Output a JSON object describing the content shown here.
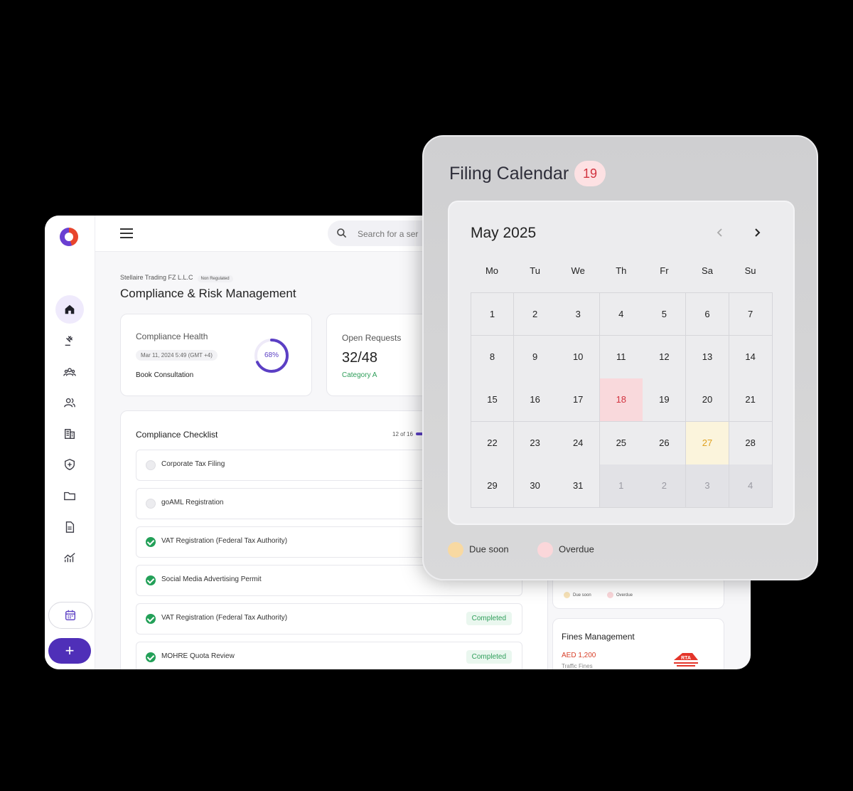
{
  "app": {
    "search_placeholder": "Search for a ser",
    "company": "Stellaire Trading FZ L.L.C",
    "company_badge": "Non Regulated",
    "page_title": "Compliance & Risk Management",
    "health": {
      "label": "Compliance Health",
      "date": "Mar 11, 2024 5:49 (GMT +4)",
      "book": "Book Consultation",
      "percent": "68%",
      "percent_value": 68
    },
    "requests": {
      "label": "Open Requests",
      "value": "32/48",
      "category": "Category A"
    },
    "checklist": {
      "title": "Compliance Checklist",
      "count": "12 of 16",
      "items": [
        {
          "label": "Corporate Tax Filing",
          "done": false,
          "status": ""
        },
        {
          "label": "goAML Registration",
          "done": false,
          "status": ""
        },
        {
          "label": "VAT Registration (Federal Tax Authority)",
          "done": true,
          "status": ""
        },
        {
          "label": "Social Media Advertising Permit",
          "done": true,
          "status": ""
        },
        {
          "label": "VAT Registration (Federal Tax Authority)",
          "done": true,
          "status": "Completed"
        },
        {
          "label": "MOHRE Quota Review",
          "done": true,
          "status": "Completed"
        }
      ]
    },
    "mini_legend": {
      "due": "Due soon",
      "overdue": "Overdue"
    },
    "fines": {
      "title": "Fines Management",
      "amount": "AED 1,200",
      "sub": "Traffic Fines",
      "logo_text": "RTA"
    }
  },
  "calendar": {
    "title": "Filing Calendar",
    "count": "19",
    "month": "May 2025",
    "weekdays": [
      "Mo",
      "Tu",
      "We",
      "Th",
      "Fr",
      "Sa",
      "Su"
    ],
    "days": [
      [
        "1",
        "2",
        "3",
        "4",
        "5",
        "6",
        "7"
      ],
      [
        "8",
        "9",
        "10",
        "11",
        "12",
        "13",
        "14"
      ],
      [
        "15",
        "16",
        "17",
        "18",
        "19",
        "20",
        "21"
      ],
      [
        "22",
        "23",
        "24",
        "25",
        "26",
        "27",
        "28"
      ],
      [
        "29",
        "30",
        "31",
        "1",
        "2",
        "3",
        "4"
      ]
    ],
    "overdue_day": "18",
    "due_day": "27",
    "legend": {
      "due": "Due soon",
      "overdue": "Overdue"
    },
    "colors": {
      "due": "#f8d9a2",
      "overdue": "#fbd7da",
      "accent": "#5b3fc4"
    }
  }
}
